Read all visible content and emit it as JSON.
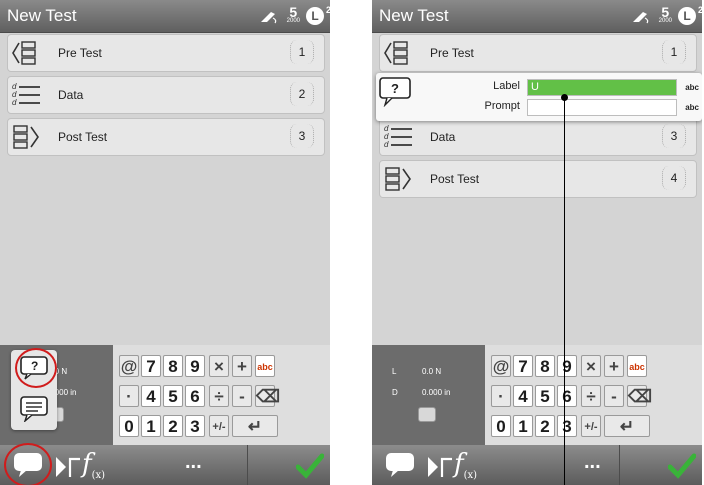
{
  "title": "New Test",
  "header": {
    "five_label": "5",
    "five_sub": "2000",
    "badge_letter": "L",
    "badge_sup": "2"
  },
  "left": {
    "rows": [
      {
        "label": "Pre Test",
        "num": "1"
      },
      {
        "label": "Data",
        "num": "2"
      },
      {
        "label": "Post Test",
        "num": "3"
      }
    ]
  },
  "right": {
    "rows": [
      {
        "label": "Pre Test",
        "num": "1"
      },
      {
        "label": "Data",
        "num": "3"
      },
      {
        "label": "Post Test",
        "num": "4"
      }
    ],
    "edit": {
      "label_caption": "Label",
      "label_value": "U",
      "label_type": "abc",
      "prompt_caption": "Prompt",
      "prompt_value": "",
      "prompt_type": "abc"
    },
    "sensor": {
      "load_tag": "L",
      "disp_tag": "D",
      "load": "0.0 N",
      "disp": "0.000 in"
    }
  },
  "left_sensor": {
    "load": "0.0 N",
    "disp": "0.000 in"
  },
  "keypad": {
    "row1": [
      "@",
      "7",
      "8",
      "9",
      "×",
      "+",
      "abc"
    ],
    "row2": [
      "·",
      "4",
      "5",
      "6",
      "÷",
      "-",
      "⌫"
    ],
    "row3": [
      "0",
      "1",
      "2",
      "3",
      "+/-",
      "↵"
    ]
  },
  "bottom": {
    "fx_label": "f",
    "fx_sub": "(x)",
    "more_label": "..."
  }
}
